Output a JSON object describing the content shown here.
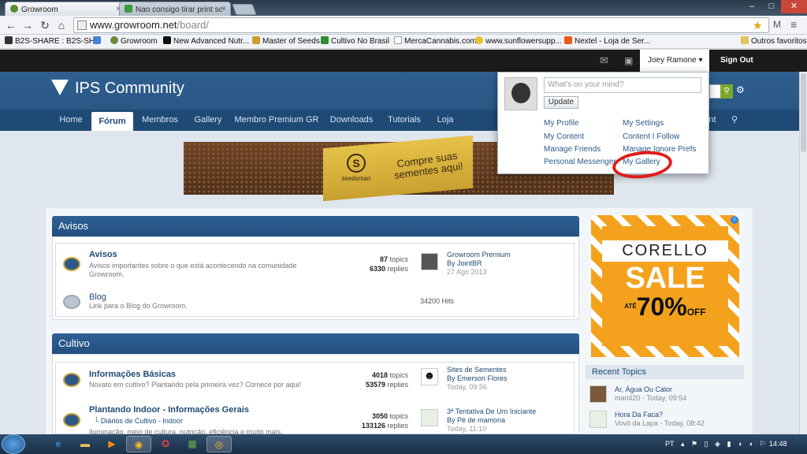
{
  "browser": {
    "tabs": [
      {
        "label": "Growroom",
        "active": true
      },
      {
        "label": "Nao consigo tirar print sc",
        "active": false
      }
    ],
    "url_host": "www.growroom.net",
    "url_path": "/board/",
    "bookmarks": [
      {
        "label": "B2S-SHARE : B2S-SH..."
      },
      {
        "label": "Growroom"
      },
      {
        "label": "New Advanced Nutr..."
      },
      {
        "label": "Master of Seeds"
      },
      {
        "label": "Cultivo No Brasil"
      },
      {
        "label": "MercaCannabis.com"
      },
      {
        "label": "www.sunflowersupp..."
      },
      {
        "label": "Nextel - Loja de Ser..."
      },
      {
        "label": "Outros favoritos"
      }
    ]
  },
  "userbar": {
    "username": "Joey Ramone",
    "signout": "Sign Out"
  },
  "site": {
    "title": "IPS Community"
  },
  "nav": [
    "Home",
    "Fórum",
    "Membros",
    "Gallery",
    "Membro Premium GR",
    "Downloads",
    "Tutorials",
    "Loja",
    "nt"
  ],
  "banner": {
    "brand": "seedsman",
    "text": "Compre suas sementes aqui!"
  },
  "popup": {
    "status_placeholder": "What's on your mind?",
    "update": "Update",
    "links_left": [
      "My Profile",
      "My Content",
      "Manage Friends",
      "Personal Messenger"
    ],
    "links_right": [
      "My Settings",
      "Content I Follow",
      "Manage Ignore Prefs",
      "My Gallery"
    ]
  },
  "categories": [
    {
      "title": "Avisos",
      "forums": [
        {
          "title": "Avisos",
          "desc": "Avisos importantes sobre o que está acontecendo na comunidade Growroom.",
          "topics": "87",
          "topics_label": "topics",
          "replies": "6330",
          "replies_label": "replies",
          "last_title": "Growroom Premium",
          "last_by": "By JointBR",
          "last_date": "27 Ago 2013"
        },
        {
          "title": "Blog",
          "desc": "Link para o Blog do Growroom.",
          "hits": "34200 Hits"
        }
      ]
    },
    {
      "title": "Cultivo",
      "forums": [
        {
          "title": "Informações Básicas",
          "desc": "Novato em cultivo? Plantando pela primeira vez? Comece por aqui!",
          "topics": "4018",
          "topics_label": "topics",
          "replies": "53579",
          "replies_label": "replies",
          "last_title": "Sites de Sementes",
          "last_by": "By Emerson Flores",
          "last_date": "Today, 09:56"
        },
        {
          "title": "Plantando Indoor - Informações Gerais",
          "sub": "Diários de Cultivo - Indoor",
          "desc": "Iluminação, meio de cultura, nutrição, eficiência e muito mais.",
          "topics": "3050",
          "topics_label": "topics",
          "replies": "133126",
          "replies_label": "replies",
          "last_title": "3ª Tentativa De Um Iniciante",
          "last_by": "By Pé de mamona",
          "last_date": "Today, 11:10"
        }
      ]
    }
  ],
  "side_ad": {
    "brand": "CORELLO",
    "sale": "SALE",
    "upto": "ATÉ",
    "pct": "70%",
    "off": "OFF"
  },
  "recent": {
    "title": "Recent Topics",
    "items": [
      {
        "title": "Ar, Água Ou Calor",
        "meta": "mari420 - Today, 09:54"
      },
      {
        "title": "Hora Da Faca?",
        "meta": "Vovô da Lapa - Today, 08:42"
      }
    ]
  },
  "taskbar": {
    "lang": "PT",
    "time": "14:48"
  }
}
